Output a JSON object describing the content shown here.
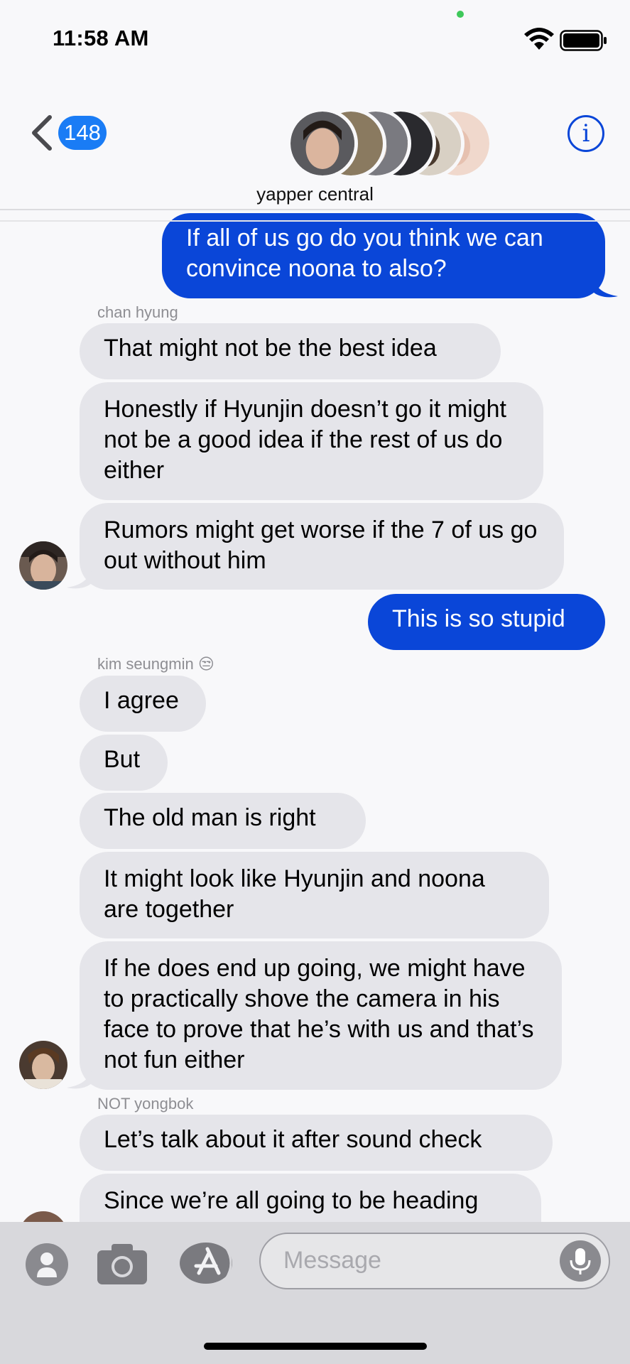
{
  "status": {
    "time": "11:58 AM"
  },
  "header": {
    "back_count": "148",
    "group_name": "yapper central",
    "info_label": "i"
  },
  "messages": [
    {
      "type": "out",
      "text": "If all of us go do you think we can convince noona to also?"
    },
    {
      "type": "sender",
      "text": "chan hyung"
    },
    {
      "type": "in",
      "text": "That might not be the best idea"
    },
    {
      "type": "in",
      "text": "Honestly if Hyunjin doesn’t go it might not be a good idea if the rest of us do either"
    },
    {
      "type": "in",
      "text": "Rumors might get worse if the 7 of us go out without him"
    },
    {
      "type": "out",
      "text": "This is so stupid"
    },
    {
      "type": "sender",
      "text": "kim seungmin 😒"
    },
    {
      "type": "in",
      "text": "I agree"
    },
    {
      "type": "in",
      "text": "But"
    },
    {
      "type": "in",
      "text": "The old man is right"
    },
    {
      "type": "in",
      "text": "It might look like Hyunjin and noona are together"
    },
    {
      "type": "in",
      "text": "If he does end up going, we might have to practically shove the camera in his face to prove that he’s with us and that’s not fun either"
    },
    {
      "type": "sender",
      "text": "NOT yongbok"
    },
    {
      "type": "in",
      "text": "Let’s talk about it after sound check"
    },
    {
      "type": "in",
      "text": "Since we’re all going to be heading"
    }
  ],
  "input": {
    "placeholder": "Message"
  },
  "icons": [
    "back-chevron-icon",
    "info-icon",
    "contacts-icon",
    "camera-icon",
    "app-store-icon",
    "microphone-icon",
    "wifi-icon",
    "battery-icon"
  ],
  "colors": {
    "outgoing": "#0a46d8",
    "incoming": "#e5e5ea",
    "badge": "#1a7cf5"
  }
}
